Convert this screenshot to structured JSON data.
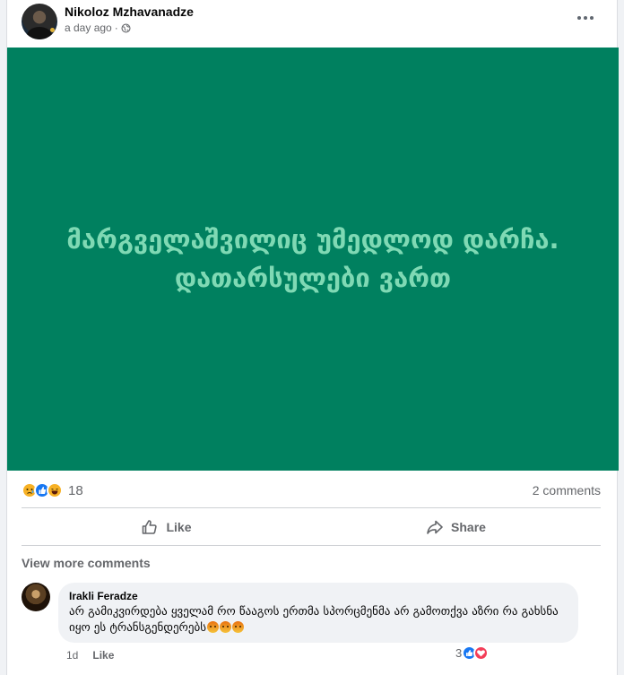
{
  "post": {
    "author": "Nikoloz Mzhavanadze",
    "timestamp": "a day ago",
    "separator": "·",
    "image_text_line1": "მარგველაშვილიც უმედლოდ დარჩა.",
    "image_text_line2": "დათარსულები ვართ",
    "reaction_count": "18",
    "comments_count": "2 comments",
    "actions": {
      "like": "Like",
      "share": "Share"
    },
    "view_more_comments": "View more comments"
  },
  "comment": {
    "author": "Irakli Feradze",
    "text": "არ გამიკვირდება ყველამ რო წააგოს ერთმა სპორცმენმა არ გამოთქვა აზრი რა გახსნა იყო ეს ტრანსგენდერებს",
    "time": "1d",
    "like": "Like",
    "reaction_count": "3"
  },
  "colors": {
    "image_bg": "#00805f",
    "image_text": "#7fd9b4",
    "like_blue": "#1877f2",
    "love_red": "#f33e58"
  },
  "icons": [
    "more-icon",
    "globe-icon",
    "sad-reaction-icon",
    "like-reaction-icon",
    "haha-reaction-icon",
    "thumbs-up-icon",
    "share-icon",
    "angry-emoji-icon",
    "love-reaction-icon"
  ]
}
